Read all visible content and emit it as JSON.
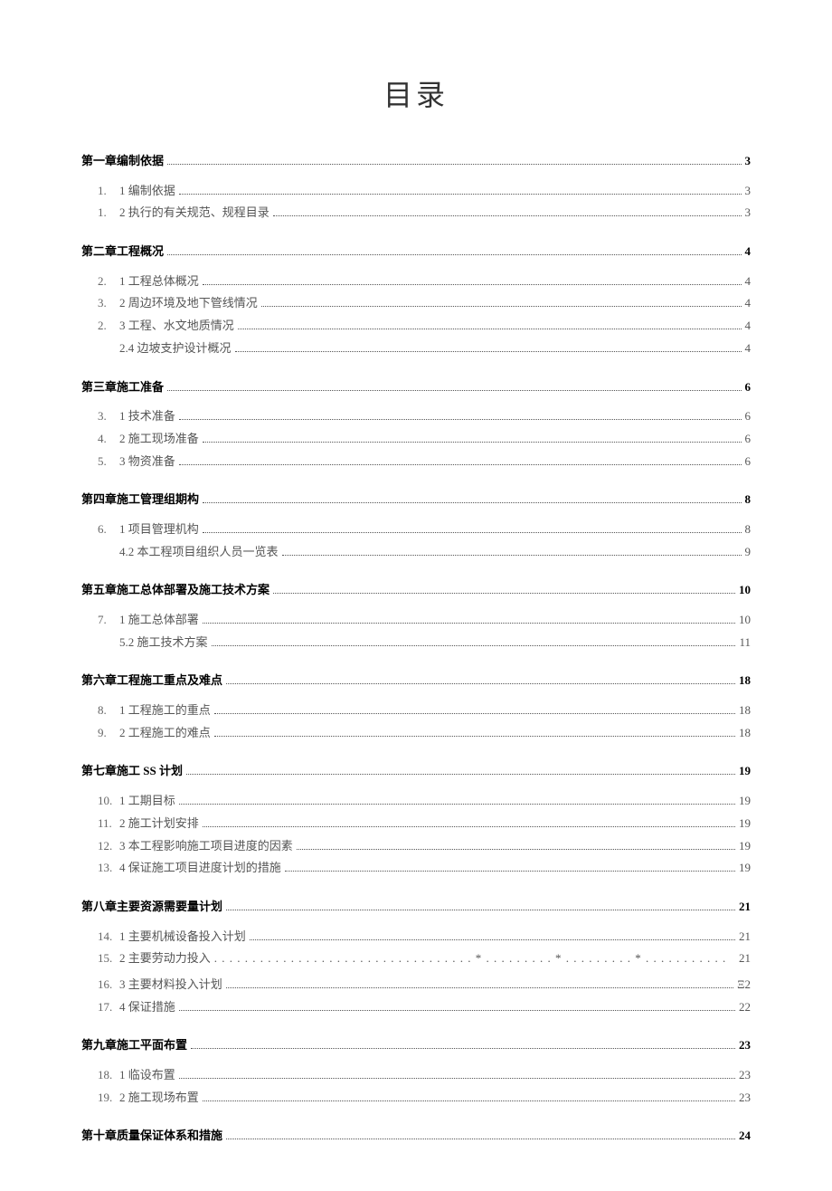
{
  "title": "目录",
  "sections": [
    {
      "label": "第一章编制依据",
      "page": "3",
      "subs": [
        {
          "prefix": "1.",
          "label": "1 编制依据",
          "page": "3"
        },
        {
          "prefix": "1.",
          "label": "2 执行的有关规范、规程目录",
          "page": "3"
        }
      ]
    },
    {
      "label": "第二章工程概况",
      "page": "4",
      "subs": [
        {
          "prefix": "2.",
          "label": "1 工程总体概况",
          "page": "4"
        },
        {
          "prefix": "3.",
          "label": "2 周边环境及地下管线情况",
          "page": "4"
        },
        {
          "prefix": "2.",
          "label": "3 工程、水文地质情况",
          "page": "4"
        },
        {
          "prefix": "",
          "label": "2.4 边坡支护设计概况",
          "page": "4"
        }
      ]
    },
    {
      "label": "第三章施工准备",
      "page": "6",
      "subs": [
        {
          "prefix": "3.",
          "label": "1 技术准备",
          "page": "6"
        },
        {
          "prefix": "4.",
          "label": "2 施工现场准备",
          "page": "6"
        },
        {
          "prefix": "5.",
          "label": "3 物资准备",
          "page": "6"
        }
      ]
    },
    {
      "label": "第四章施工管理组期构",
      "page": "8",
      "subs": [
        {
          "prefix": "6.",
          "label": "1 项目管理机构",
          "page": "8"
        },
        {
          "prefix": "",
          "label": "4.2 本工程项目组织人员一览表",
          "page": "9"
        }
      ]
    },
    {
      "label": "第五章施工总体部署及施工技术方案",
      "page": "10",
      "subs": [
        {
          "prefix": "7.",
          "label": "1 施工总体部署",
          "page": "10"
        },
        {
          "prefix": "",
          "label": "5.2 施工技术方案",
          "page": "11"
        }
      ]
    },
    {
      "label": "第六章工程施工重点及难点",
      "page": "18",
      "subs": [
        {
          "prefix": "8.",
          "label": "1 工程施工的重点",
          "page": "18"
        },
        {
          "prefix": "9.",
          "label": "2 工程施工的难点",
          "page": "18"
        }
      ]
    },
    {
      "label": "第七章施工 SS 计划",
      "page": "19",
      "subs": [
        {
          "prefix": "10.",
          "label": "1 工期目标",
          "page": "19"
        },
        {
          "prefix": "11.",
          "label": "2 施工计划安排",
          "page": "19"
        },
        {
          "prefix": "12.",
          "label": "3 本工程影响施工项目进度的因素",
          "page": "19"
        },
        {
          "prefix": "13.",
          "label": "4 保证施工项目进度计划的措施",
          "page": "19"
        }
      ]
    },
    {
      "label": "第八章主要资源需要量计划",
      "page": "21",
      "subs": [
        {
          "prefix": "14.",
          "label": "1 主要机械设备投入计划",
          "page": "21"
        },
        {
          "prefix": "15.",
          "label": "2 主要劳动力投入",
          "page": "21",
          "leader": "star"
        },
        {
          "prefix": "16.",
          "label": "3 主要材料投入计划",
          "page": "Ξ2"
        },
        {
          "prefix": "17.",
          "label": "4 保证措施",
          "page": "22"
        }
      ]
    },
    {
      "label": "第九章施工平面布置",
      "page": "23",
      "subs": [
        {
          "prefix": "18.",
          "label": "1 临设布置",
          "page": "23"
        },
        {
          "prefix": "19.",
          "label": "2 施工现场布置",
          "page": "23"
        }
      ]
    },
    {
      "label": "第十章质量保证体系和措施",
      "page": "24",
      "subs": []
    }
  ]
}
